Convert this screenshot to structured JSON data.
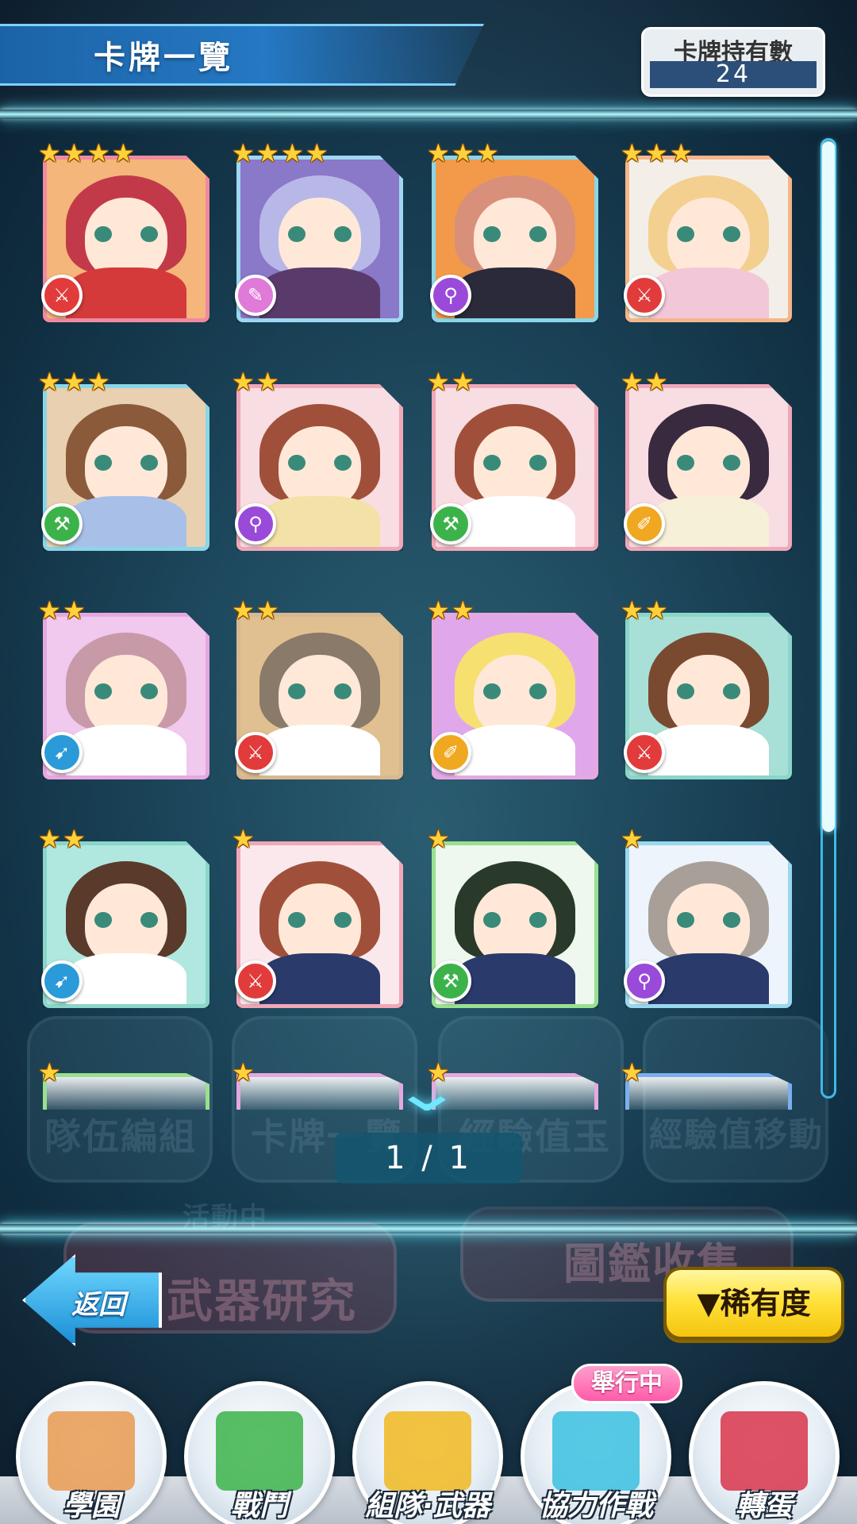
{
  "header": {
    "title": "卡牌一覽",
    "count_label": "卡牌持有數",
    "count_value": "24"
  },
  "cards": [
    {
      "stars": 4,
      "frame": "#f08aa0",
      "bg": "#f4b67a",
      "hair": "#c23a4a",
      "body": "#d43a3a",
      "weapon": "sword",
      "weapon_color": "#e23b3b"
    },
    {
      "stars": 4,
      "frame": "#9fd8f0",
      "bg": "#8a78c8",
      "hair": "#b8b8e8",
      "body": "#5a3a6a",
      "weapon": "dagger",
      "weapon_color": "#e07ad8"
    },
    {
      "stars": 3,
      "frame": "#8ad6e8",
      "bg": "#f39a4a",
      "hair": "#d8907a",
      "body": "#2a2a3a",
      "weapon": "staff",
      "weapon_color": "#9a4ad8"
    },
    {
      "stars": 3,
      "frame": "#f6b68a",
      "bg": "#f3efe8",
      "hair": "#f3d090",
      "body": "#f2c8d8",
      "weapon": "sword",
      "weapon_color": "#e23b3b"
    },
    {
      "stars": 3,
      "frame": "#8ad6e8",
      "bg": "#e9d0b0",
      "hair": "#8a5a3a",
      "body": "#a8c0e8",
      "weapon": "hammer",
      "weapon_color": "#3cb34a"
    },
    {
      "stars": 2,
      "frame": "#f0a8b8",
      "bg": "#f8dde2",
      "hair": "#a0503a",
      "body": "#f3e2a8",
      "weapon": "staff",
      "weapon_color": "#9a4ad8"
    },
    {
      "stars": 2,
      "frame": "#f0a8b8",
      "bg": "#f8dde2",
      "hair": "#a0503a",
      "body": "#ffffff",
      "weapon": "hammer",
      "weapon_color": "#3cb34a"
    },
    {
      "stars": 2,
      "frame": "#f0a8b8",
      "bg": "#f8dde2",
      "hair": "#3a2a40",
      "body": "#f6f0d8",
      "weapon": "brush",
      "weapon_color": "#f0a820"
    },
    {
      "stars": 2,
      "frame": "#e6a8e0",
      "bg": "#f1c8ee",
      "hair": "#c89aa8",
      "body": "#ffffff",
      "weapon": "gun",
      "weapon_color": "#2a9ad8"
    },
    {
      "stars": 2,
      "frame": "#d8b890",
      "bg": "#e0c090",
      "hair": "#8a7a6a",
      "body": "#ffffff",
      "weapon": "sword",
      "weapon_color": "#e23b3b"
    },
    {
      "stars": 2,
      "frame": "#e6a8e0",
      "bg": "#e0a8ea",
      "hair": "#f6e070",
      "body": "#ffffff",
      "weapon": "brush",
      "weapon_color": "#f0a820"
    },
    {
      "stars": 2,
      "frame": "#8ad6c8",
      "bg": "#a8e0d8",
      "hair": "#7a4a30",
      "body": "#ffffff",
      "weapon": "sword",
      "weapon_color": "#e23b3b"
    },
    {
      "stars": 2,
      "frame": "#8ad6c8",
      "bg": "#b0e8e0",
      "hair": "#5a3a2a",
      "body": "#ffffff",
      "weapon": "gun",
      "weapon_color": "#2a9ad8"
    },
    {
      "stars": 1,
      "frame": "#f0a8b8",
      "bg": "#fbe8ec",
      "hair": "#a0503a",
      "body": "#2a3a6a",
      "weapon": "sword",
      "weapon_color": "#e23b3b"
    },
    {
      "stars": 1,
      "frame": "#9ae090",
      "bg": "#eef8ee",
      "hair": "#2a3a2a",
      "body": "#2a3a6a",
      "weapon": "hammer",
      "weapon_color": "#3cb34a"
    },
    {
      "stars": 1,
      "frame": "#9ad8ee",
      "bg": "#eef4fb",
      "hair": "#a8a098",
      "body": "#2a3a6a",
      "weapon": "staff",
      "weapon_color": "#9a4ad8"
    }
  ],
  "peek_cards": [
    {
      "stars": 1,
      "frame": "#9ae090"
    },
    {
      "stars": 1,
      "frame": "#e6a8e0"
    },
    {
      "stars": 1,
      "frame": "#e6a8e0"
    },
    {
      "stars": 1,
      "frame": "#7ab0ee"
    }
  ],
  "background_menu": [
    "隊伍編組",
    "卡牌一覽",
    "經驗值玉",
    "經驗值移動",
    "活動中",
    "武器研究",
    "圖鑑收集"
  ],
  "pager": "1 / 1",
  "buttons": {
    "back": "返回",
    "rarity": "▼稀有度"
  },
  "nav": [
    {
      "label": "學園",
      "icon": "school-icon",
      "color": "#e89a50"
    },
    {
      "label": "戰鬥",
      "icon": "battle-board-icon",
      "color": "#3cb34a"
    },
    {
      "label": "組隊·武器",
      "icon": "compass-star-icon",
      "color": "#f0b820"
    },
    {
      "label": "協力作戰",
      "icon": "team-people-icon",
      "color": "#3ac0e0"
    },
    {
      "label": "轉蛋",
      "icon": "gacha-book-icon",
      "color": "#d8344a"
    }
  ],
  "event_badge": "舉行中",
  "weapon_glyphs": {
    "sword": "⚔",
    "dagger": "✎",
    "staff": "⚲",
    "hammer": "⚒",
    "brush": "✐",
    "gun": "➹"
  }
}
